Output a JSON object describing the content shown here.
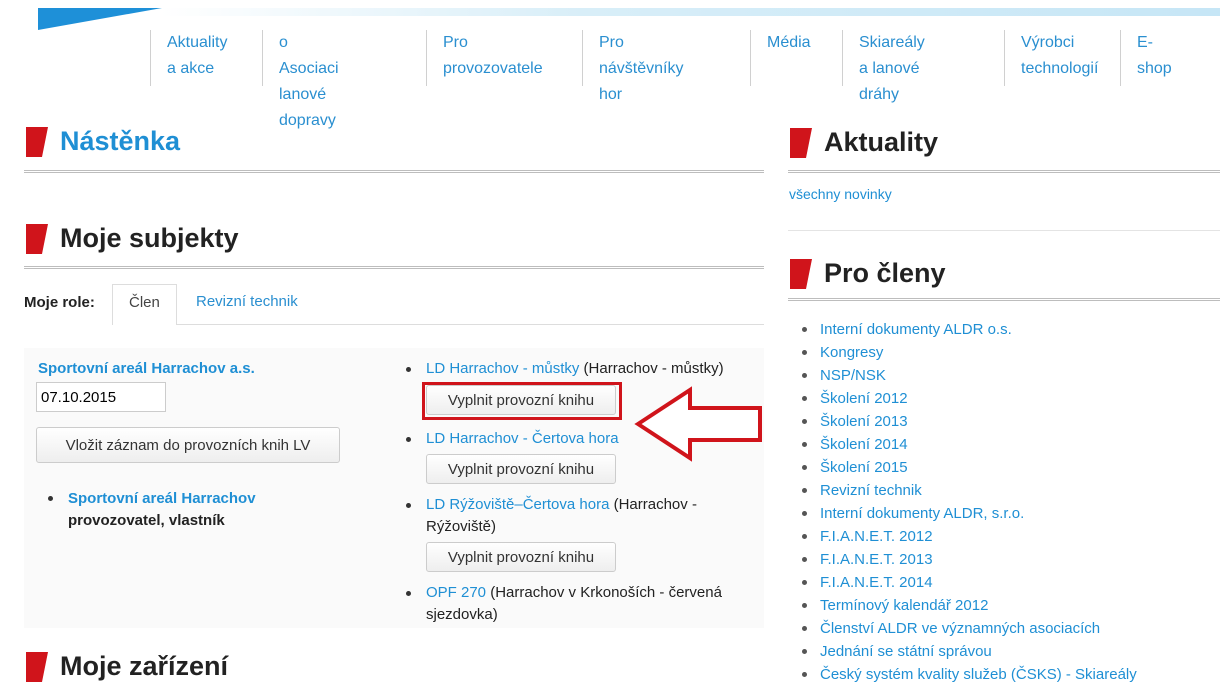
{
  "nav": [
    {
      "line1": "Aktuality",
      "line2": "a akce"
    },
    {
      "line1": "o Asociaci",
      "line2": "lanové dopravy"
    },
    {
      "line1": "Pro",
      "line2": "provozovatele"
    },
    {
      "line1": "Pro",
      "line2": "návštěvníky hor"
    },
    {
      "line1": "Média",
      "line2": ""
    },
    {
      "line1": "Skiareály",
      "line2": "a lanové dráhy"
    },
    {
      "line1": "Výrobci",
      "line2": "technologií"
    },
    {
      "line1": "E-shop",
      "line2": ""
    }
  ],
  "left": {
    "dashboard_title": "Nástěnka",
    "subjects_title": "Moje subjekty",
    "roles_label": "Moje role:",
    "tab_member": "Člen",
    "tab_inspector": "Revizní technik",
    "company_name": "Sportovní areál Harrachov a.s.",
    "date_value": "07.10.2015",
    "add_record_button": "Vložit záznam do provozních knih LV",
    "company_item_name": "Sportovní areál Harrachov",
    "company_item_roles": "provozovatel, vlastník",
    "devices_title": "Moje zařízení"
  },
  "lifts": [
    {
      "name": "LD Harrachov - můstky",
      "location": " (Harrachov - můstky)",
      "button": "Vyplnit provozní knihu"
    },
    {
      "name": "LD Harrachov - Čertova hora",
      "location": "",
      "button": "Vyplnit provozní knihu"
    },
    {
      "name": "LD Rýžoviště–Čertova hora",
      "location": " (Harrachov - Rýžoviště)",
      "button": "Vyplnit provozní knihu"
    },
    {
      "name": "OPF 270",
      "location": " (Harrachov v Krkonoších - červená sjezdovka)",
      "button": ""
    }
  ],
  "right": {
    "news_title": "Aktuality",
    "all_news_link": "všechny novinky",
    "members_title": "Pro členy",
    "members_links": [
      "Interní dokumenty ALDR o.s.",
      "Kongresy",
      "NSP/NSK",
      "Školení 2012",
      "Školení 2013",
      "Školení 2014",
      "Školení 2015",
      "Revizní technik",
      "Interní dokumenty ALDR, s.r.o.",
      "F.I.A.N.E.T. 2012",
      "F.I.A.N.E.T. 2013",
      "F.I.A.N.E.T. 2014",
      "Termínový kalendář 2012",
      "Členství ALDR ve významných asociacích",
      "Jednání se státní správou",
      "Český systém kvality služeb (ČSKS) - Skiareály"
    ]
  },
  "colors": {
    "accent_blue": "#1f8fd4",
    "flag_red": "#d0141b",
    "highlight_red": "#d0141b"
  }
}
